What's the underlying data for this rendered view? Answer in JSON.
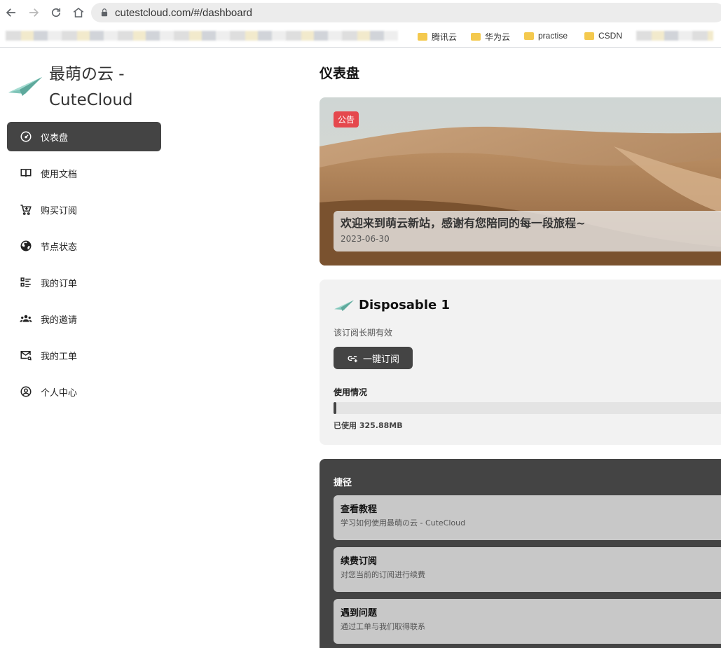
{
  "browser": {
    "url": "cutestcloud.com/#/dashboard",
    "bookmarks": [
      "腾讯云",
      "华为云",
      "practise",
      "CSDN"
    ]
  },
  "brand": {
    "title": "最萌の云 - CuteCloud"
  },
  "sidebar": {
    "items": [
      {
        "label": "仪表盘",
        "icon": "gauge-icon",
        "active": true
      },
      {
        "label": "使用文档",
        "icon": "book-icon",
        "active": false
      },
      {
        "label": "购买订阅",
        "icon": "cart-icon",
        "active": false
      },
      {
        "label": "节点状态",
        "icon": "globe-icon",
        "active": false
      },
      {
        "label": "我的订单",
        "icon": "checklist-icon",
        "active": false
      },
      {
        "label": "我的邀请",
        "icon": "people-icon",
        "active": false
      },
      {
        "label": "我的工单",
        "icon": "mail-icon",
        "active": false
      },
      {
        "label": "个人中心",
        "icon": "user-circle-icon",
        "active": false
      }
    ]
  },
  "main": {
    "title": "仪表盘",
    "notice": {
      "badge": "公告",
      "title": "欢迎来到萌云新站，感谢有您陪同的每一段旅程~",
      "date": "2023-06-30"
    },
    "subscription": {
      "name": "Disposable 1",
      "validity": "该订阅长期有效",
      "subscribe_label": "一键订阅",
      "usage_label": "使用情况",
      "usage_text": "已使用 325.88MB",
      "usage_fraction": 0.005
    },
    "shortcuts": {
      "title": "捷径",
      "items": [
        {
          "title": "查看教程",
          "desc": "学习如何使用最萌の云 - CuteCloud"
        },
        {
          "title": "续费订阅",
          "desc": "对您当前的订阅进行续费"
        },
        {
          "title": "遇到问题",
          "desc": "通过工单与我们取得联系"
        }
      ]
    }
  },
  "colors": {
    "accent": "#444444",
    "badge": "#e5484d",
    "plane": "#7fc4b8"
  }
}
